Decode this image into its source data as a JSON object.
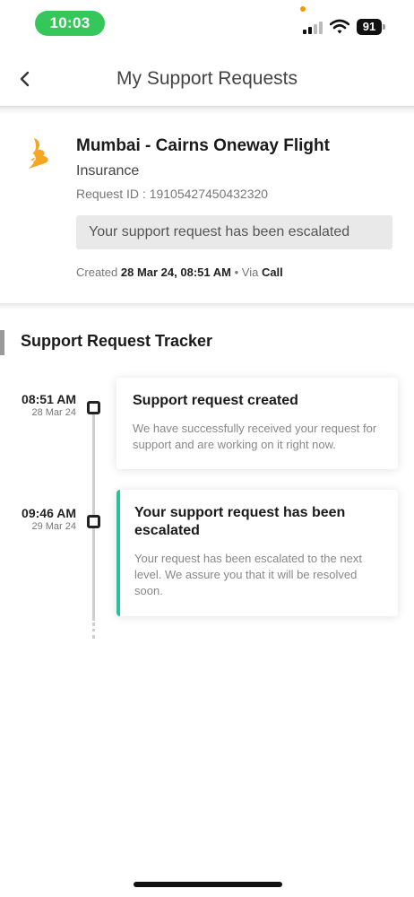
{
  "status_bar": {
    "time": "10:03",
    "battery": "91"
  },
  "header": {
    "title": "My Support Requests"
  },
  "request": {
    "title": "Mumbai - Cairns Oneway Flight",
    "category": "Insurance",
    "request_id": "Request ID : 19105427450432320",
    "status_banner": "Your support request has been escalated",
    "created_prefix": "Created",
    "created_at": "28 Mar 24, 08:51 AM",
    "via_prefix": "• Via",
    "via": "Call"
  },
  "tracker": {
    "title": "Support Request Tracker",
    "events": [
      {
        "time": "08:51 AM",
        "date": "28 Mar 24",
        "title": "Support request created",
        "description": "We have successfully received your request for support and are working on it right now."
      },
      {
        "time": "09:46 AM",
        "date": "29 Mar 24",
        "title": "Your support request has been escalated",
        "description": "Your request has been escalated to the next level. We assure you that it will be resolved soon."
      }
    ]
  },
  "colors": {
    "time_pill": "#35c759",
    "active_accent": "#2bbf9b",
    "logo": "#f5a623"
  }
}
